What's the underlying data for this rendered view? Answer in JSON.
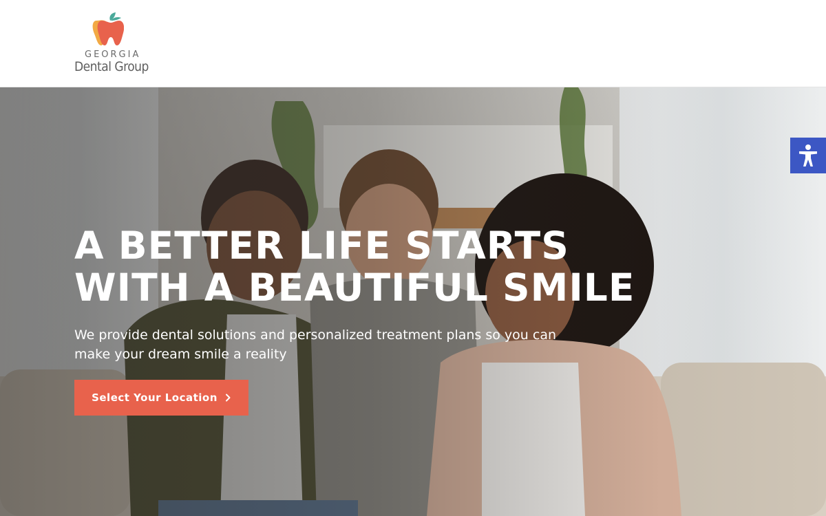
{
  "header": {
    "logo": {
      "line1": "GEORGIA",
      "line2": "Dental Group",
      "icon": "tooth-leaf-icon",
      "colors": {
        "tooth": "#e8624c",
        "tooth_shadow": "#f2a944",
        "leaf": "#4aa99a"
      }
    }
  },
  "hero": {
    "title_lines": [
      "A BETTER LIFE STARTS",
      "WITH A BEAUTIFUL SMILE"
    ],
    "subtitle": "We provide dental solutions and personalized treatment plans so you can make your dream smile a reality",
    "cta": {
      "label": "Select Your Location",
      "icon": "chevron-right-icon"
    },
    "image": "family-smiling-on-couch-photo"
  },
  "accessibility": {
    "icon": "accessibility-person-icon"
  },
  "colors": {
    "accent": "#e8624c",
    "accessibility_blue": "#3c57c4",
    "text_on_hero": "#ffffff"
  }
}
